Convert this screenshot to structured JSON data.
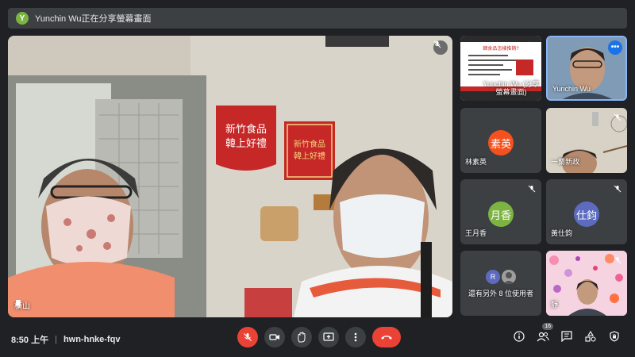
{
  "banner": {
    "avatar_letter": "Y",
    "text": "Yunchin Wu正在分享螢幕畫面"
  },
  "main": {
    "name": "橫山",
    "poster1": "新竹食品 韓上好禮",
    "poster2": "新竹食品 韓上好禮"
  },
  "tiles": [
    {
      "name": "Yunchin Wu (分享螢幕畫面)",
      "slide_title": "韓食品怎樣推銷?"
    },
    {
      "name": "Yunchin Wu"
    },
    {
      "avatar": "素英",
      "name": "林素英",
      "color": "#f4511e"
    },
    {
      "name": "一蘭新政"
    },
    {
      "avatar": "月香",
      "name": "王月香",
      "color": "#7cb342"
    },
    {
      "avatar": "仕鈞",
      "name": "黃仕鈞",
      "color": "#5c6bc0"
    },
    {
      "avatar": "R",
      "name": "還有另外 8 位使用者",
      "color": "#5c6bc0"
    },
    {
      "name": "靜"
    }
  ],
  "bottom": {
    "time": "8:50 上午",
    "separator": "|",
    "meeting_code": "hwn-hnke-fqv",
    "people_count": "16"
  },
  "colors": {
    "background": "#202124",
    "tile": "#3c4043",
    "danger": "#ea4335",
    "accent": "#1a73e8"
  }
}
